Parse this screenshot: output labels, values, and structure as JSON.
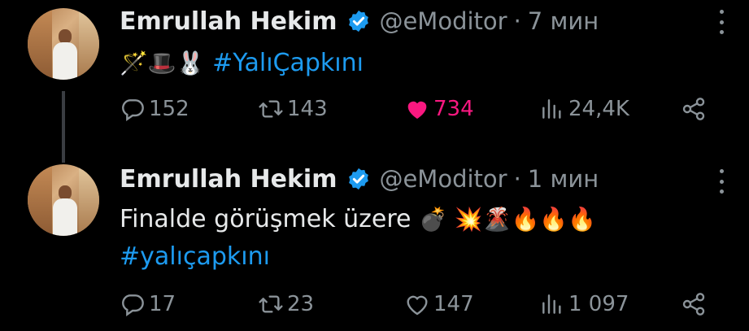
{
  "tweets": [
    {
      "author": {
        "name": "Emrullah Hekim",
        "handle": "@eModitor"
      },
      "time": "7 мин",
      "emojis": "🪄🎩🐰",
      "hashtag": "#YalıÇapkını",
      "body_line": "",
      "stats": {
        "replies": "152",
        "retweets": "143",
        "likes": "734",
        "views": "24,4K"
      },
      "liked": true
    },
    {
      "author": {
        "name": "Emrullah Hekim",
        "handle": "@eModitor"
      },
      "time": "1 мин",
      "body_line": "Finalde görüşmek üzere",
      "emojis": "💣 💥🌋🔥🔥🔥",
      "hashtag": "#yalıçapkını",
      "stats": {
        "replies": "17",
        "retweets": "23",
        "likes": "147",
        "views": "1 097"
      },
      "liked": false
    }
  ],
  "icons": {
    "verified": "verified-badge-icon",
    "reply": "reply-icon",
    "retweet": "retweet-icon",
    "like": "heart-icon",
    "views": "views-icon",
    "share": "share-icon",
    "more": "more-icon"
  },
  "colors": {
    "accent": "#1d9bf0",
    "like": "#f91880",
    "muted": "#8b9399",
    "background": "#000000"
  }
}
